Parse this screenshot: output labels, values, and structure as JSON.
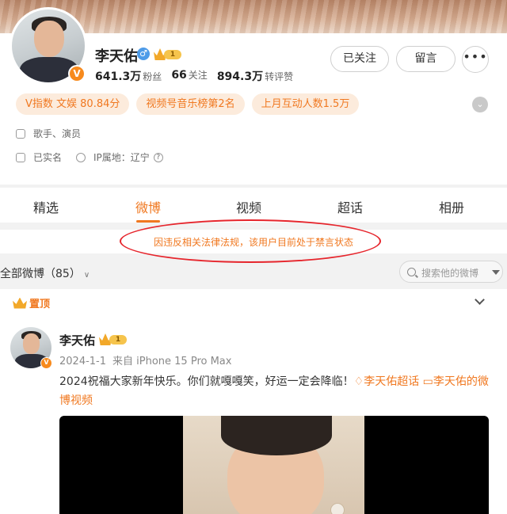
{
  "profile": {
    "name": "李天佑",
    "gender_icon": "male-icon",
    "verified_badge": "V",
    "member_level": "1",
    "stats": [
      {
        "value": "641.3万",
        "label": "粉丝"
      },
      {
        "value": "66",
        "label": "关注"
      },
      {
        "value": "894.3万",
        "label": "转评赞"
      }
    ],
    "buttons": {
      "follow": "已关注",
      "message": "留言",
      "more": "•••"
    },
    "tags": [
      "V指数 文娱 80.84分",
      "视频号音乐榜第2名",
      "上月互动人数1.5万"
    ],
    "occupation": "歌手、演员",
    "verification": "已实名",
    "ip_location": "IP属地：辽宁",
    "ip_help": "?"
  },
  "tabs": [
    {
      "label": "精选",
      "active": false
    },
    {
      "label": "微博",
      "active": true
    },
    {
      "label": "视频",
      "active": false
    },
    {
      "label": "超话",
      "active": false
    },
    {
      "label": "相册",
      "active": false
    }
  ],
  "notice": {
    "text": "因违反相关法律法规，该用户目前处于禁言状态",
    "highlight_color": "#e6262d"
  },
  "feed": {
    "title": "全部微博（85）",
    "search_placeholder": "搜索他的微博"
  },
  "post": {
    "pinned_label": "置顶",
    "author": "李天佑",
    "date": "2024-1-1",
    "source": "来自 iPhone 15 Pro Max",
    "text": "2024祝福大家新年快乐。你们就嘎嘎笑，好运一定会降临！",
    "link_supertopic": "李天佑超话",
    "link_videos": "李天佑的微博视频"
  },
  "colors": {
    "accent": "#f07820",
    "tag_bg": "#fcebdc",
    "verified": "#f78a1d",
    "male": "#4d9be8"
  }
}
